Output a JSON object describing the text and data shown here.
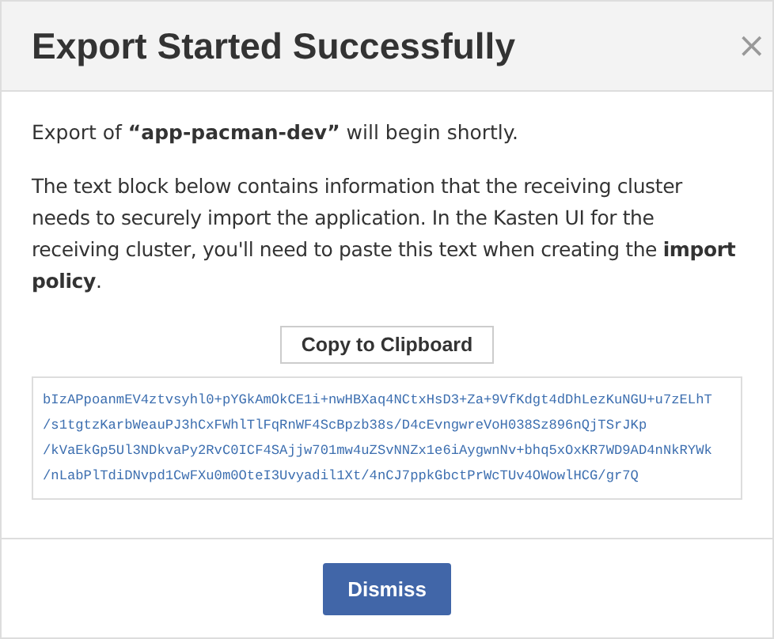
{
  "dialog": {
    "title": "Export Started Successfully",
    "close": "×",
    "message": "Export of **“app-pacman-dev”** will begin shortly.",
    "description": "The text block below contains information that the receiving cluster needs to securely import the application. In the Kasten UI for the receiving cluster, you'll need to paste this text when creating the **import policy**.",
    "copy_button": "Copy to Clipboard",
    "text_block": [
      "bIzAPpoanmEV4ztvsyhl0+pYGkAmOkCE1i+nwHBXaq4NCtxHsD3+Za+9VfKdgt4dDhLezKuNGU+u7zELhT",
      "/s1tgtzKarbWeauPJ3hCxFWhlTlFqRnWF4ScBpzb38s/D4cEvngwreVoH038Sz896nQjTSrJKp",
      "/kVaEkGp5Ul3NDkvaPy2RvC0ICF4SAjjw701mw4uZSvNNZx1e6iAygwnNv+bhq5xOxKR7WD9AD4nNkRYWk",
      "/nLabPlTdiDNvpd1CwFXu0m0OteI3Uvyadil1Xt/4nCJ7ppkGbctPrWcTUv4OWowlHCG/gr7Q"
    ],
    "dismiss_button": "Dismiss"
  }
}
